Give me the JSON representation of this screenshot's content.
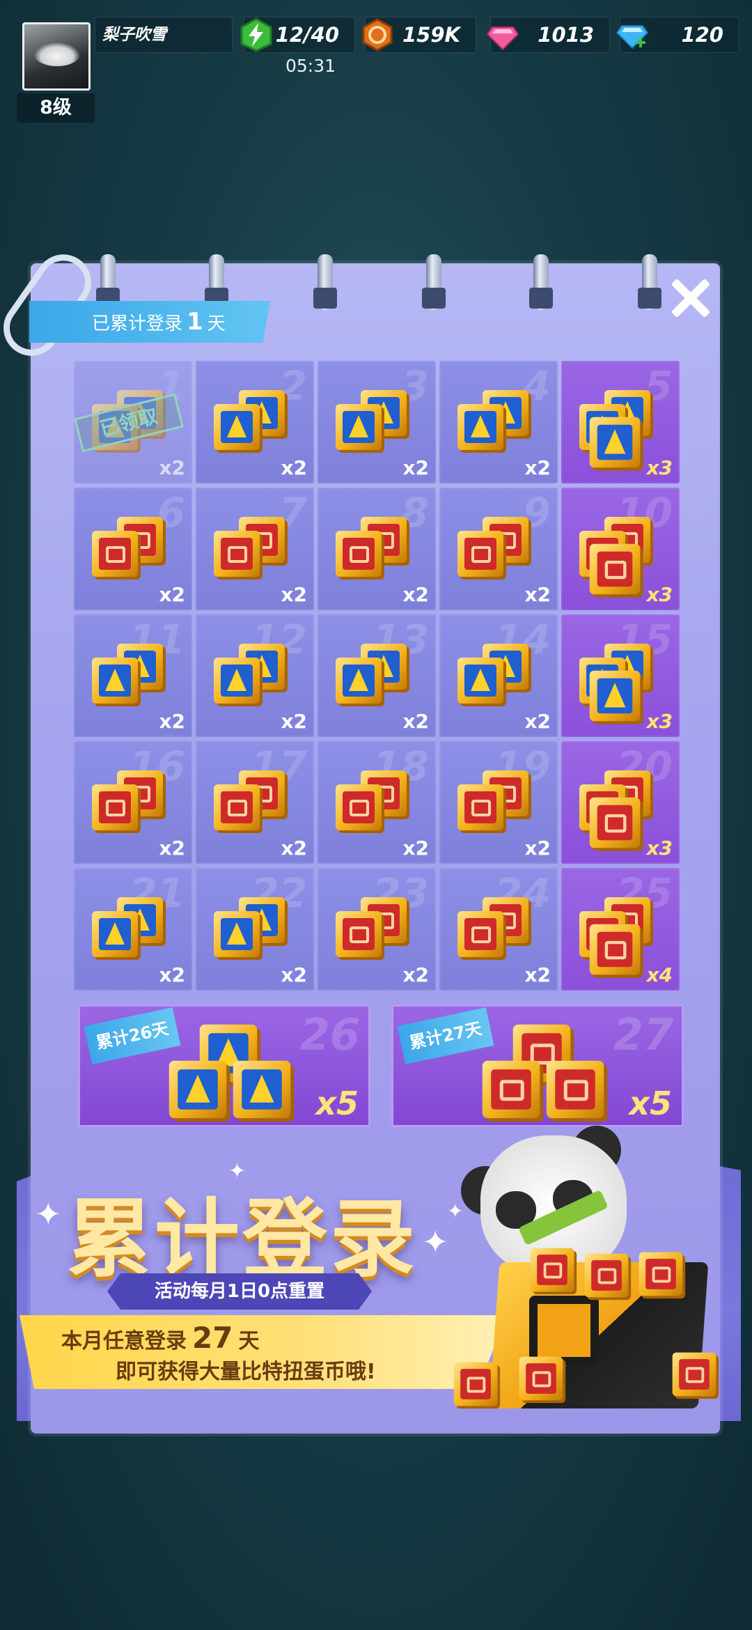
{
  "hud": {
    "player_name": "梨子吹雪",
    "level": "8级",
    "energy": "12/40",
    "energy_timer": "05:31",
    "coins": "159K",
    "pink_gems": "1013",
    "blue_gems": "120"
  },
  "panel": {
    "login_prefix": "已累计登录",
    "login_days": "1",
    "login_suffix": "天"
  },
  "rewards": [
    {
      "day": "1",
      "qty": "x2",
      "type": "blue",
      "claimed": true
    },
    {
      "day": "2",
      "qty": "x2",
      "type": "blue"
    },
    {
      "day": "3",
      "qty": "x2",
      "type": "blue"
    },
    {
      "day": "4",
      "qty": "x2",
      "type": "blue"
    },
    {
      "day": "5",
      "qty": "x3",
      "type": "blue",
      "big": true
    },
    {
      "day": "6",
      "qty": "x2",
      "type": "red"
    },
    {
      "day": "7",
      "qty": "x2",
      "type": "red"
    },
    {
      "day": "8",
      "qty": "x2",
      "type": "red"
    },
    {
      "day": "9",
      "qty": "x2",
      "type": "red"
    },
    {
      "day": "10",
      "qty": "x3",
      "type": "red",
      "big": true
    },
    {
      "day": "11",
      "qty": "x2",
      "type": "blue"
    },
    {
      "day": "12",
      "qty": "x2",
      "type": "blue"
    },
    {
      "day": "13",
      "qty": "x2",
      "type": "blue"
    },
    {
      "day": "14",
      "qty": "x2",
      "type": "blue"
    },
    {
      "day": "15",
      "qty": "x3",
      "type": "blue",
      "big": true
    },
    {
      "day": "16",
      "qty": "x2",
      "type": "red"
    },
    {
      "day": "17",
      "qty": "x2",
      "type": "red"
    },
    {
      "day": "18",
      "qty": "x2",
      "type": "red"
    },
    {
      "day": "19",
      "qty": "x2",
      "type": "red"
    },
    {
      "day": "20",
      "qty": "x3",
      "type": "red",
      "big": true
    },
    {
      "day": "21",
      "qty": "x2",
      "type": "blue"
    },
    {
      "day": "22",
      "qty": "x2",
      "type": "blue"
    },
    {
      "day": "23",
      "qty": "x2",
      "type": "red"
    },
    {
      "day": "24",
      "qty": "x2",
      "type": "red"
    },
    {
      "day": "25",
      "qty": "x4",
      "type": "red",
      "big": true
    }
  ],
  "claimed_label": "已领取",
  "bonus": [
    {
      "tag": "累计26天",
      "day": "26",
      "qty": "x5",
      "type": "blue"
    },
    {
      "tag": "累计27天",
      "day": "27",
      "qty": "x5",
      "type": "red"
    }
  ],
  "banner": {
    "title": "累计登录",
    "reset_note": "活动每月1日0点重置",
    "line1_prefix": "本月任意登录",
    "line1_days": "27",
    "line1_suffix": "天",
    "line2": "即可获得大量比特扭蛋币哦!"
  },
  "colors": {
    "panel_bg": "#a7a6ef",
    "cell_bg": "#8d90e6",
    "cell_big_bg": "#9a67e4",
    "accent_blue": "#3aa7e8",
    "gold": "#f4b21b"
  },
  "icons": {
    "energy": "lightning-bolt-icon",
    "coin": "coin-icon",
    "pink_gem": "pink-diamond-icon",
    "blue_gem": "blue-diamond-icon",
    "close": "close-icon"
  }
}
